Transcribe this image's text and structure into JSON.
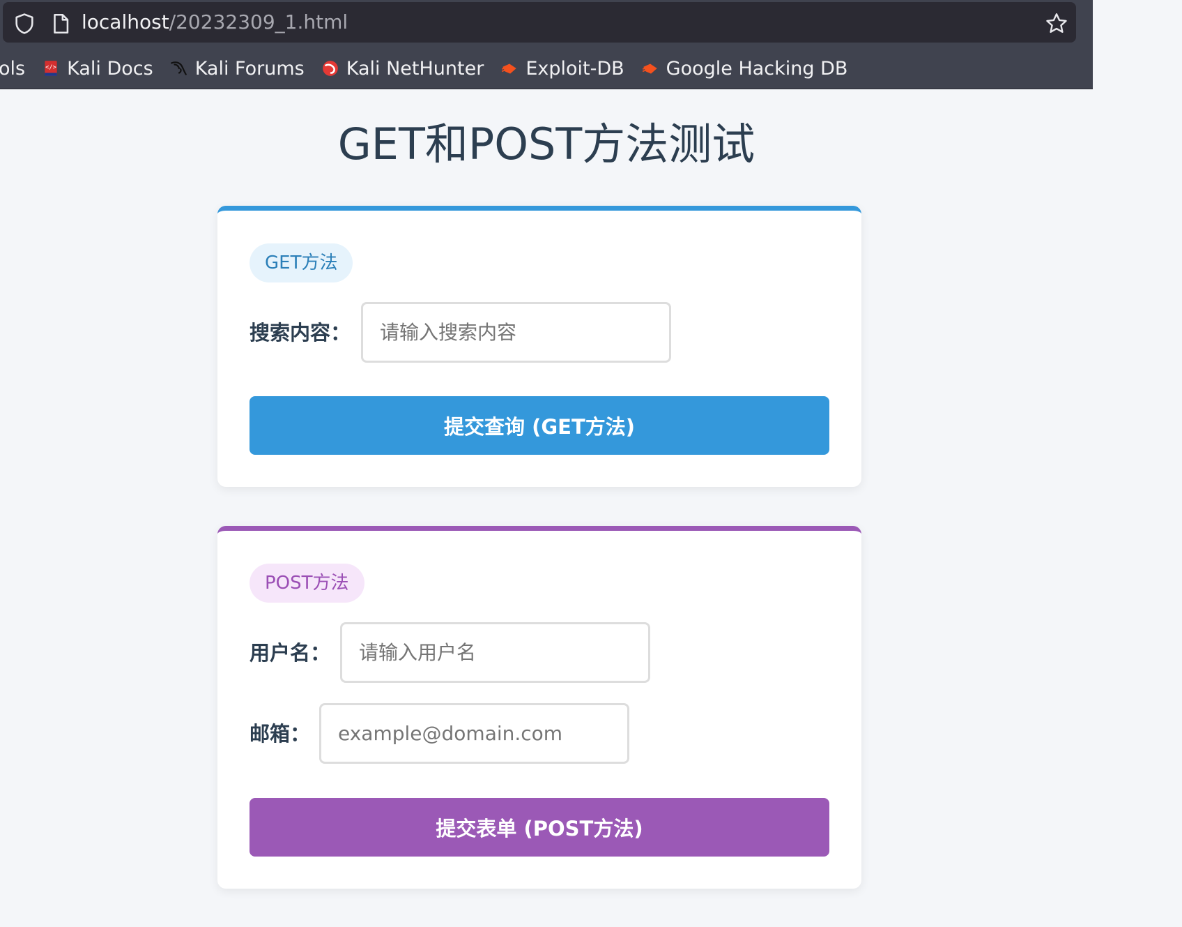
{
  "browser": {
    "url_host": "localhost",
    "url_path": "/20232309_1.html",
    "bookmarks": [
      {
        "label": "ols",
        "icon": "none"
      },
      {
        "label": "Kali Docs",
        "icon": "kali-docs-icon"
      },
      {
        "label": "Kali Forums",
        "icon": "kali-dragon-icon"
      },
      {
        "label": "Kali NetHunter",
        "icon": "nethunter-icon"
      },
      {
        "label": "Exploit-DB",
        "icon": "exploit-db-icon"
      },
      {
        "label": "Google Hacking DB",
        "icon": "exploit-db-icon"
      }
    ]
  },
  "page": {
    "title": "GET和POST方法测试"
  },
  "get_form": {
    "badge": "GET方法",
    "search_label": "搜索内容：",
    "search_placeholder": "请输入搜索内容",
    "submit_label": "提交查询 (GET方法)",
    "accent_color": "#3498db"
  },
  "post_form": {
    "badge": "POST方法",
    "username_label": "用户名：",
    "username_placeholder": "请输入用户名",
    "email_label": "邮箱：",
    "email_placeholder": "example@domain.com",
    "submit_label": "提交表单 (POST方法)",
    "accent_color": "#9b59b6"
  }
}
